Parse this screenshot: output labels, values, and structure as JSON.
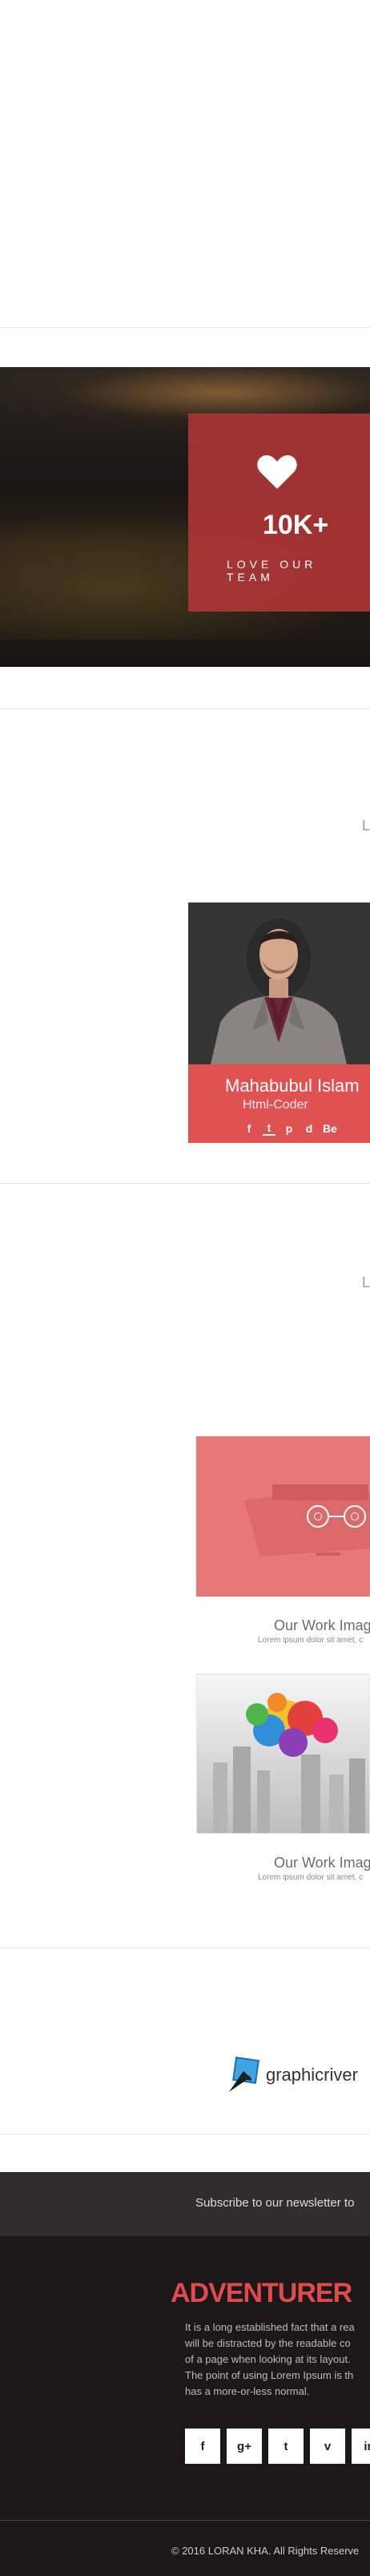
{
  "stats": {
    "number": "10K+",
    "label": "LOVE OUR TEAM",
    "icon": "heart-icon"
  },
  "team": {
    "edge_letter": "L",
    "member": {
      "name": "Mahabubul Islam",
      "role": "Html-Coder",
      "social": [
        "f",
        "t",
        "p",
        "d",
        "Be"
      ]
    }
  },
  "work": {
    "edge_letter": "L",
    "items": [
      {
        "title": "Our Work Imag",
        "desc": "Lorem ipsum dolor sit amet, c"
      },
      {
        "title": "Our Work Imag",
        "desc": "Lorem ipsum dolor sit amet, c"
      }
    ]
  },
  "client": {
    "name": "graphicriver"
  },
  "newsletter": {
    "text": "Subscribe to our newsletter to"
  },
  "footer": {
    "brand": "ADVENTURER",
    "about_lines": [
      "It is a long established fact that a rea",
      "will be distracted by the readable co",
      "of a page when looking at its layout.",
      "The point of using Lorem Ipsum is th",
      "has a more-or-less normal."
    ],
    "social": [
      "f",
      "g+",
      "t",
      "v",
      "in"
    ],
    "copyright": "© 2016 LORAN KHA. All Rights Reserve"
  },
  "colors": {
    "accent": "#e05252",
    "brand": "#e14a4a",
    "footer_bg": "#1a1819"
  }
}
